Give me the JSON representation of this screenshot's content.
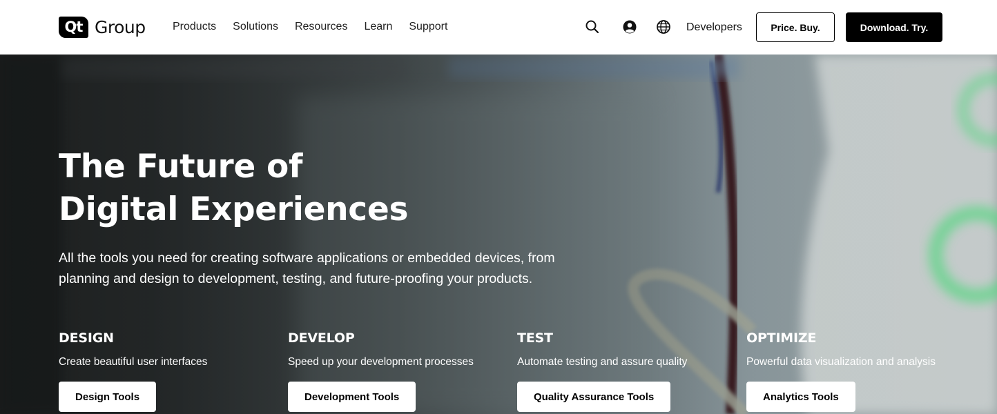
{
  "header": {
    "logo_mark": "Qt",
    "logo_word": "Group",
    "nav": [
      {
        "label": "Products"
      },
      {
        "label": "Solutions"
      },
      {
        "label": "Resources"
      },
      {
        "label": "Learn"
      },
      {
        "label": "Support"
      }
    ],
    "icons": [
      "search-icon",
      "user-account-icon",
      "globe-icon"
    ],
    "developers_label": "Developers",
    "price_button": "Price. Buy.",
    "download_button": "Download. Try."
  },
  "hero": {
    "title_line1": "The Future of",
    "title_line2": "Digital Experiences",
    "subtitle_line1": "All the tools you need for creating software applications or embedded devices, from",
    "subtitle_line2": "planning and design to development, testing, and future-proofing your products.",
    "columns": [
      {
        "heading": "DESIGN",
        "description": "Create beautiful user interfaces",
        "button": "Design Tools"
      },
      {
        "heading": "DEVELOP",
        "description": "Speed up your development processes",
        "button": "Development Tools"
      },
      {
        "heading": "TEST",
        "description": "Automate testing and assure quality",
        "button": "Quality Assurance Tools"
      },
      {
        "heading": "OPTIMIZE",
        "description": "Powerful data visualization and analysis",
        "button": "Analytics Tools"
      }
    ]
  },
  "colors": {
    "header_bg": "#ffffff",
    "primary_button_bg": "#000000",
    "hero_text": "#ffffff",
    "accent_glow": "#5ee08a"
  }
}
